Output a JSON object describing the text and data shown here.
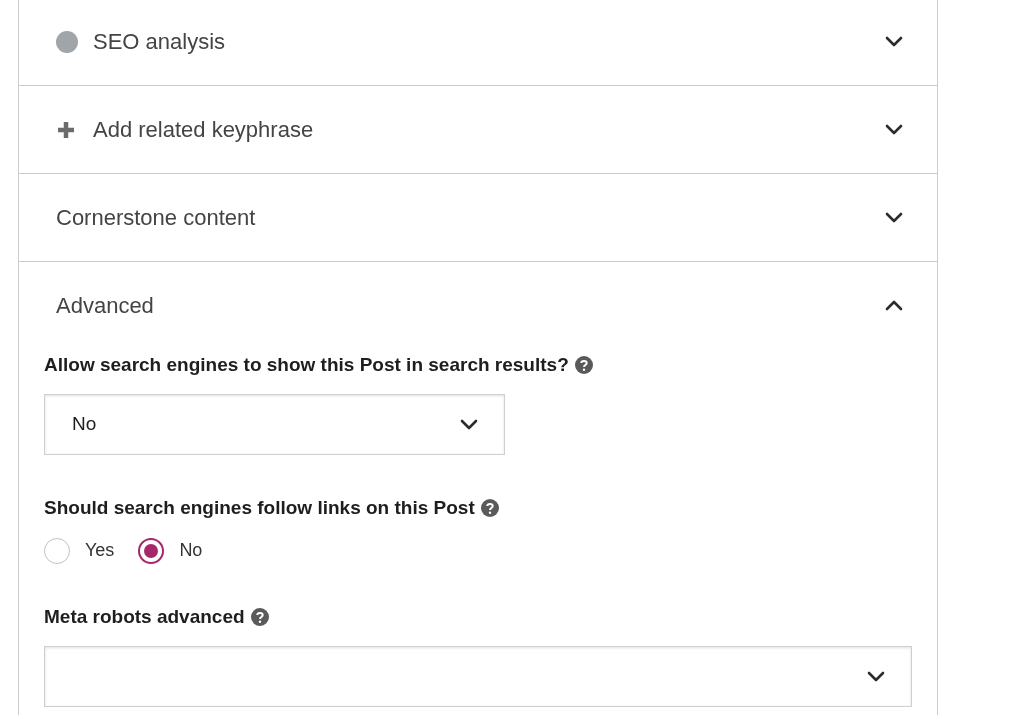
{
  "sections": [
    {
      "kind": "status",
      "title": "SEO analysis",
      "expanded": false
    },
    {
      "kind": "add",
      "title": "Add related keyphrase",
      "expanded": false
    },
    {
      "kind": "plain",
      "title": "Cornerstone content",
      "expanded": false
    },
    {
      "kind": "plain",
      "title": "Advanced",
      "expanded": true,
      "fields": [
        {
          "kind": "select",
          "label": "Allow search engines to show this Post in search results?",
          "value": "No"
        },
        {
          "kind": "radio",
          "label": "Should search engines follow links on this Post",
          "options": [
            {
              "label": "Yes",
              "selected": false
            },
            {
              "label": "No",
              "selected": true
            }
          ]
        },
        {
          "kind": "multiselect",
          "label": "Meta robots advanced"
        }
      ]
    }
  ]
}
